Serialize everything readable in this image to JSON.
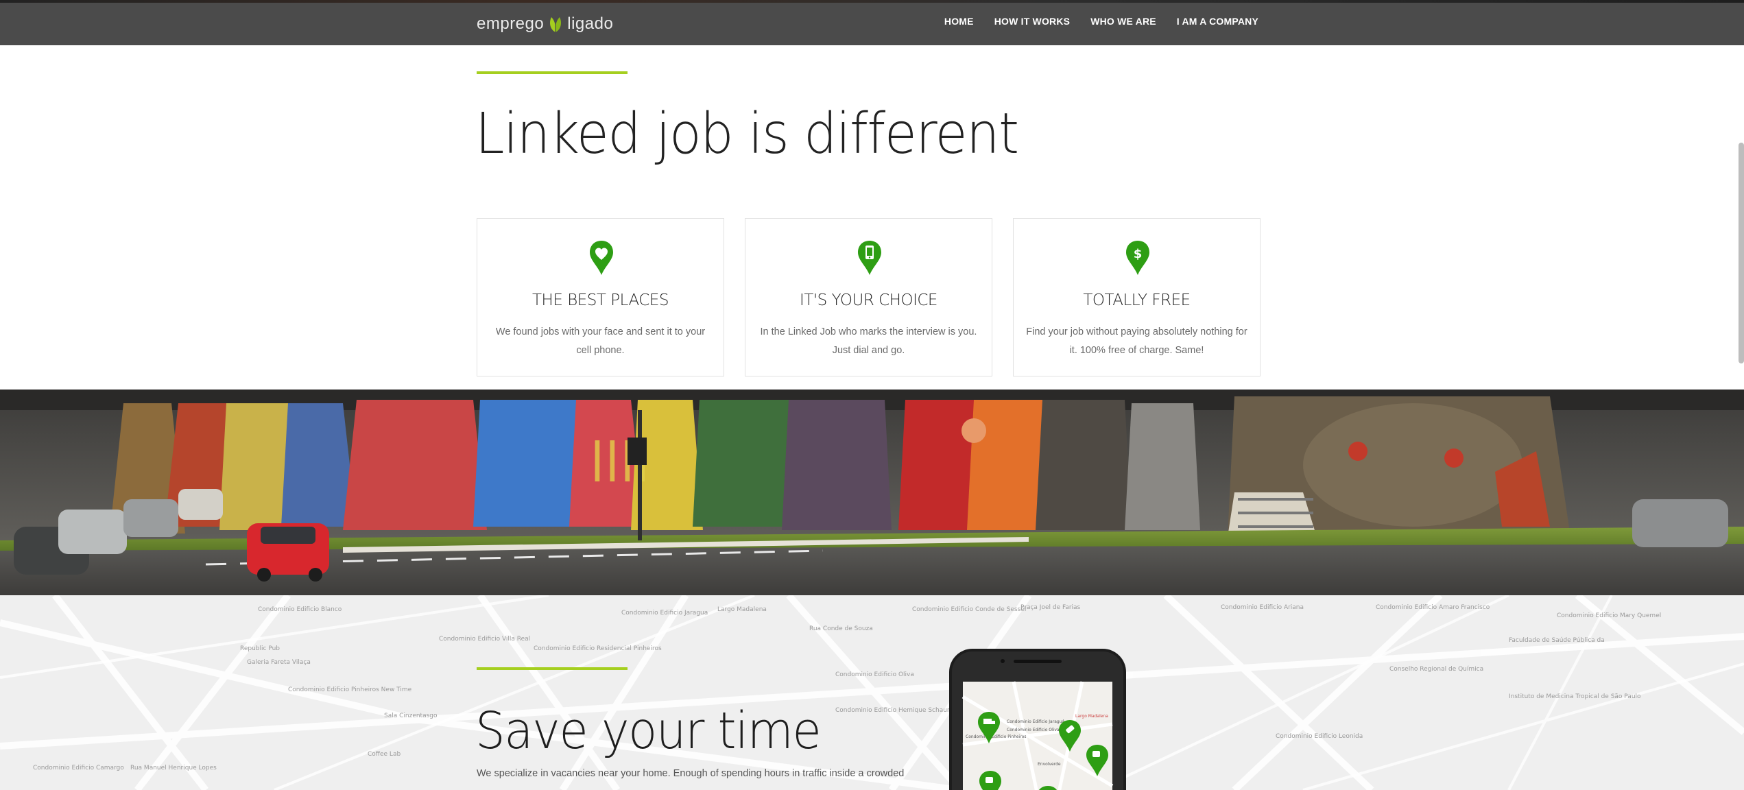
{
  "brand": {
    "logo_left": "emprego",
    "logo_right": "ligado",
    "accent_color": "#a5cf1f",
    "icon_green": "#2e9e14"
  },
  "nav": {
    "items": [
      "HOME",
      "HOW IT WORKS",
      "WHO WE ARE",
      "I AM A COMPANY"
    ]
  },
  "intro": {
    "title": "Linked job is different"
  },
  "features": [
    {
      "icon": "heart-pin-icon",
      "title": "THE BEST PLACES",
      "description": "We found jobs with your face and sent it to your cell phone."
    },
    {
      "icon": "phone-pin-icon",
      "title": "IT'S YOUR CHOICE",
      "description": "In the Linked Job who marks the interview is you.\nJust dial and go."
    },
    {
      "icon": "dollar-pin-icon",
      "title": "TOTALLY FREE",
      "description": "Find your job without paying absolutely nothing for it. 100% free of charge. Same!"
    }
  ],
  "save_time": {
    "title": "Save your time",
    "description": "We specialize in vacancies near your home. Enough of spending hours in traffic inside a crowded"
  },
  "map_labels": [
    "Condominio Edificio Blanco",
    "Condominio Edificio Villa Real",
    "Republic Pub",
    "Galeria Fareta Vilaça",
    "Condominio Edificio Residencial Pinheiros",
    "Condominio Edificio Jaragua",
    "Largo Madalena",
    "Rua Conde de Souza",
    "Condominio Edificio Conde de Sessel",
    "Praça Joel de Farias",
    "Condominio Edificio Ariana",
    "Condominio Edificio Amaro Francisco",
    "Condominio Edificio Mary Quemel",
    "Faculdade de Saúde Pública da",
    "Instituto de Medicina Tropical de São Paulo",
    "Conselho Regional de Química",
    "Condominio Edificio Pinheiros New Time",
    "Condominio Edificio Hemique Schaumann",
    "Condominio Edificio Leonida",
    "Condominio Edificio Oliva",
    "Coffee Lab",
    "Rua Manuel Henrique Lopes",
    "Sala Cinzentasgo",
    "Condominio Edificio Camargo"
  ],
  "phone_map": {
    "labels": [
      "Condominio Edificio Jaraguá",
      "Largo Madalena",
      "Condominio Edificio Oliva",
      "Condominio Edificio Pinheiros",
      "Envolverde"
    ],
    "pins": [
      "truck-icon",
      "tag-icon",
      "cup-icon",
      "cup-icon",
      "pin-icon"
    ]
  }
}
